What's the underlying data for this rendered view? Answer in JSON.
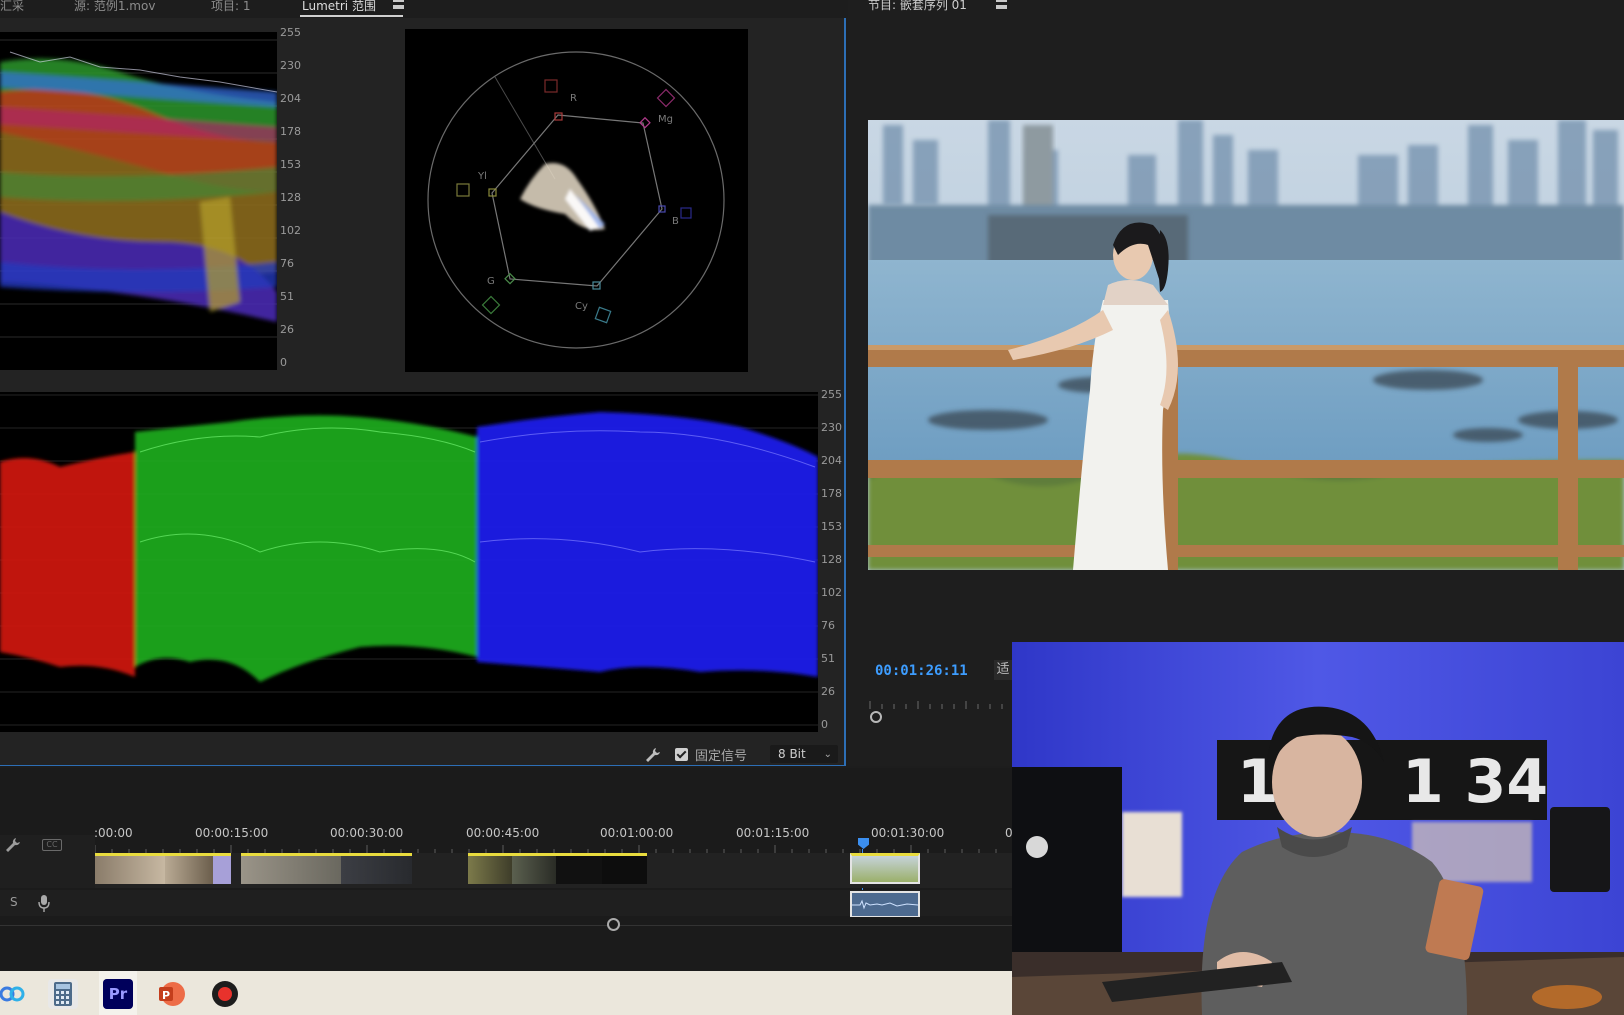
{
  "tabs": {
    "effects_partial": "汇采",
    "source": "源: 范例1.mov",
    "project": "项目: 1",
    "lumetri": "Lumetri 范围"
  },
  "scopes": {
    "scale_values": [
      "255",
      "230",
      "204",
      "178",
      "153",
      "128",
      "102",
      "76",
      "51",
      "26",
      "0"
    ],
    "vectorscope_targets": [
      "R",
      "Mg",
      "B",
      "Cy",
      "G",
      "Yl"
    ],
    "clamp_signal_label": "固定信号",
    "clamp_signal_checked": true,
    "bit_depth": "8 Bit"
  },
  "program_monitor": {
    "title": "节目: 嵌套序列 01",
    "timecode": "00:01:26:11",
    "fit_label": "适"
  },
  "timeline": {
    "ruler_labels": [
      ":00:00",
      "00:00:15:00",
      "00:00:30:00",
      "00:00:45:00",
      "00:01:00:00",
      "00:01:15:00",
      "00:01:30:00",
      "0"
    ],
    "audio_track_label": "S"
  },
  "taskbar": {
    "apps": [
      "baidu-netdisk-icon",
      "calculator-icon",
      "premiere-pro-icon",
      "powerpoint-icon",
      "screen-recorder-icon"
    ],
    "premiere_label": "Pr",
    "powerpoint_label": "P"
  },
  "webcam": {
    "clock_left": "1",
    "clock_right": "1 34"
  },
  "colors": {
    "accent_blue": "#2d6fb6",
    "timecode_blue": "#3d9dff",
    "clip_yellow": "#e9dc3e"
  }
}
